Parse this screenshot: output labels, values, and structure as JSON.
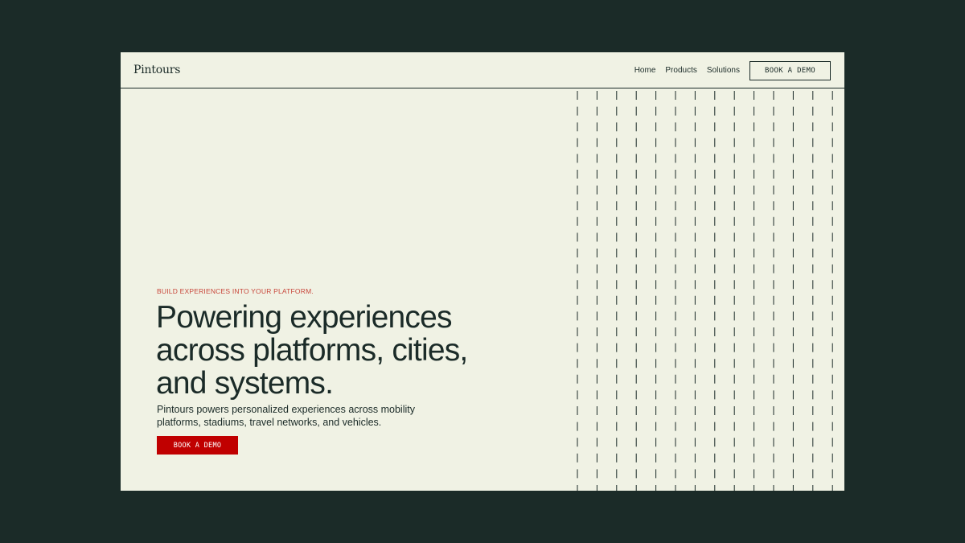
{
  "brand": {
    "logo_text": "Pintours"
  },
  "nav": {
    "items": [
      "Home",
      "Products",
      "Solutions"
    ],
    "cta_label": "BOOK A DEMO"
  },
  "hero": {
    "eyebrow": "BUILD EXPERIENCES INTO YOUR PLATFORM.",
    "headline_lines": [
      "Powering experiences",
      "across platforms, cities,",
      "and systems."
    ],
    "subtext_lines": [
      "Pintours powers personalized experiences across mobility",
      "platforms, stadiums, travel networks, and vehicles."
    ],
    "cta_label": "BOOK A DEMO"
  },
  "colors": {
    "page_background": "#1b2b28",
    "frame_background": "#f0f2e4",
    "text": "#1b2b28",
    "accent": "#c00000",
    "eyebrow": "#c8463a"
  }
}
